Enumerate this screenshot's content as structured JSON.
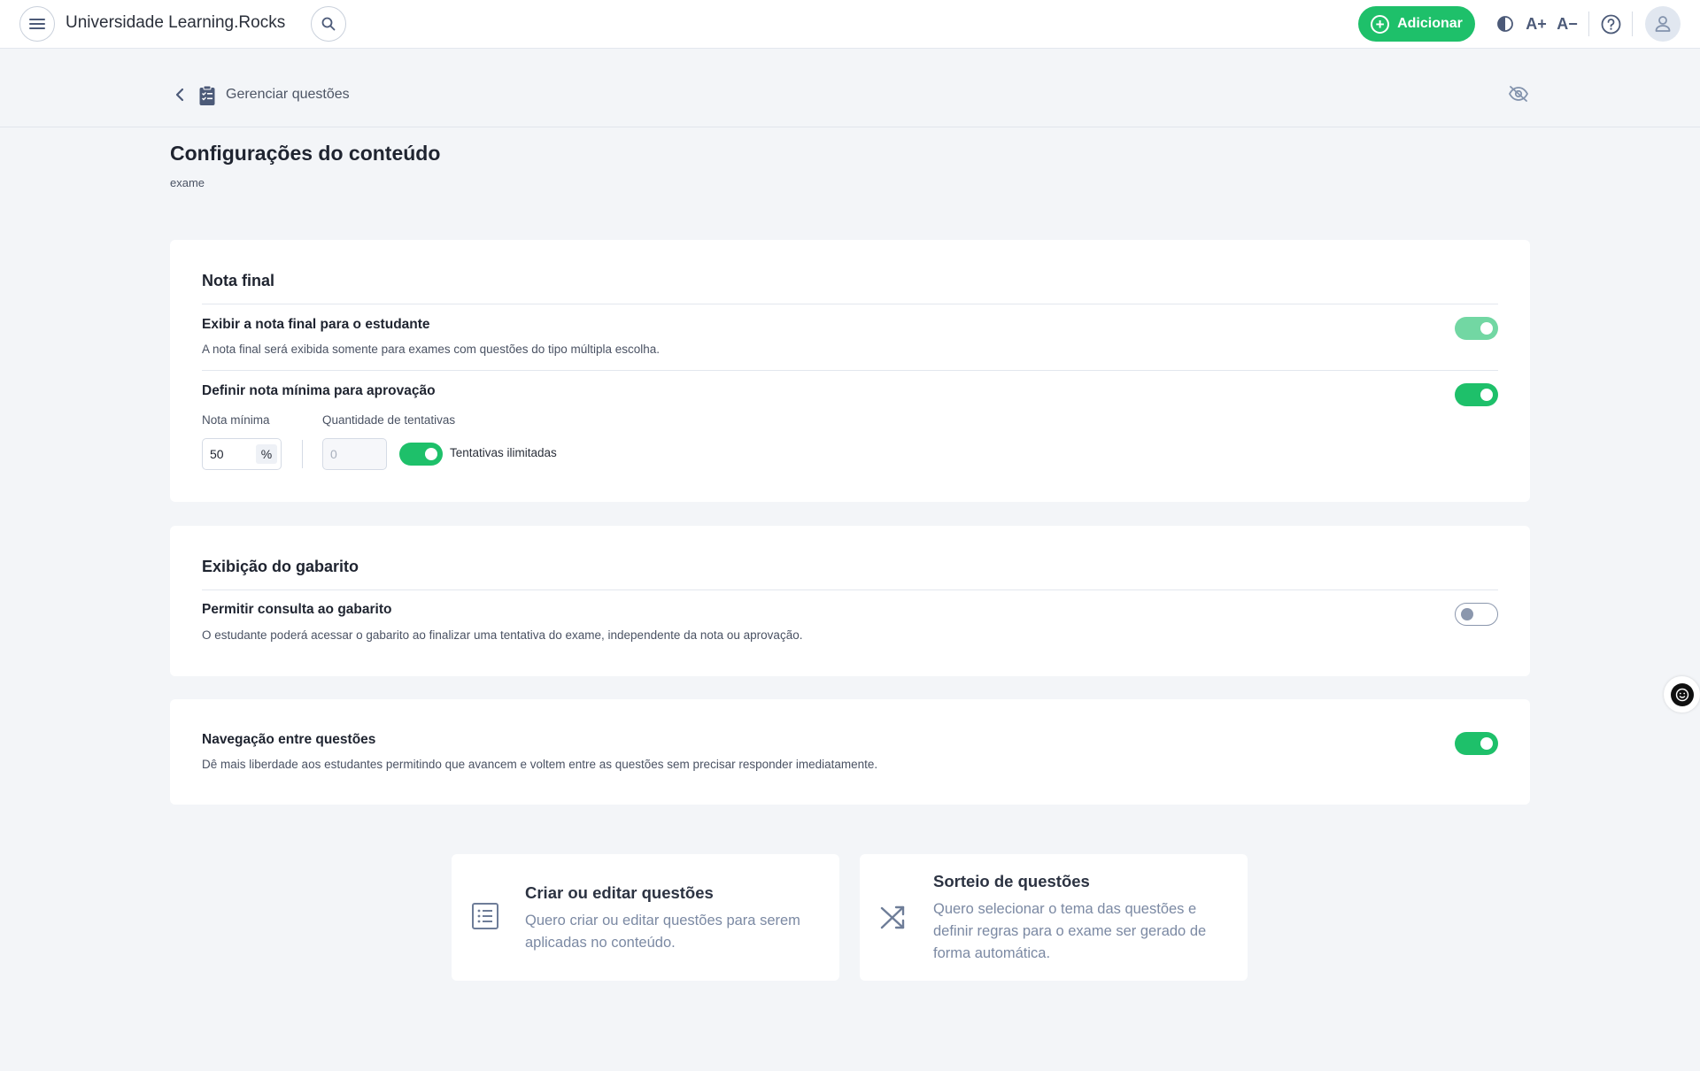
{
  "topbar": {
    "app_title": "Universidade Learning.Rocks",
    "add_label": "Adicionar",
    "font_increase": "A+",
    "font_decrease": "A−"
  },
  "subheader": {
    "title": "Gerenciar questões"
  },
  "page": {
    "title": "Configurações do conteúdo",
    "subtitle": "exame"
  },
  "nota_final": {
    "title": "Nota final",
    "exibir": {
      "label": "Exibir a nota final para o estudante",
      "description": "A nota final será exibida somente para exames com questões do tipo múltipla escolha.",
      "enabled": true
    },
    "nota_minima": {
      "label": "Definir nota mínima para aprovação",
      "enabled": true,
      "min_label": "Nota mínima",
      "min_value": "50",
      "min_unit": "%",
      "attempts_label": "Quantidade de tentativas",
      "attempts_placeholder": "0",
      "unlimited_label": "Tentativas ilimitadas",
      "unlimited_enabled": true
    }
  },
  "gabarito": {
    "title": "Exibição do gabarito",
    "permitir": {
      "label": "Permitir consulta ao gabarito",
      "description": "O estudante poderá acessar o gabarito ao finalizar uma tentativa do exame, independente da nota ou aprovação.",
      "enabled": false
    }
  },
  "navegacao": {
    "label": "Navegação entre questões",
    "description": "Dê mais liberdade aos estudantes permitindo que avancem e voltem entre as questões sem precisar responder imediatamente.",
    "enabled": true
  },
  "actions": [
    {
      "title": "Criar ou editar questões",
      "description": "Quero criar ou editar questões para serem aplicadas no conteúdo.",
      "icon": "list-icon"
    },
    {
      "title": "Sorteio de questões",
      "description": "Quero selecionar o tema das questões e definir regras para o exame ser gerado de forma automática.",
      "icon": "shuffle-icon"
    }
  ],
  "colors": {
    "accent_green": "#1ec06a",
    "muted_blue": "#7b89a3",
    "background": "#f3f5f8"
  }
}
